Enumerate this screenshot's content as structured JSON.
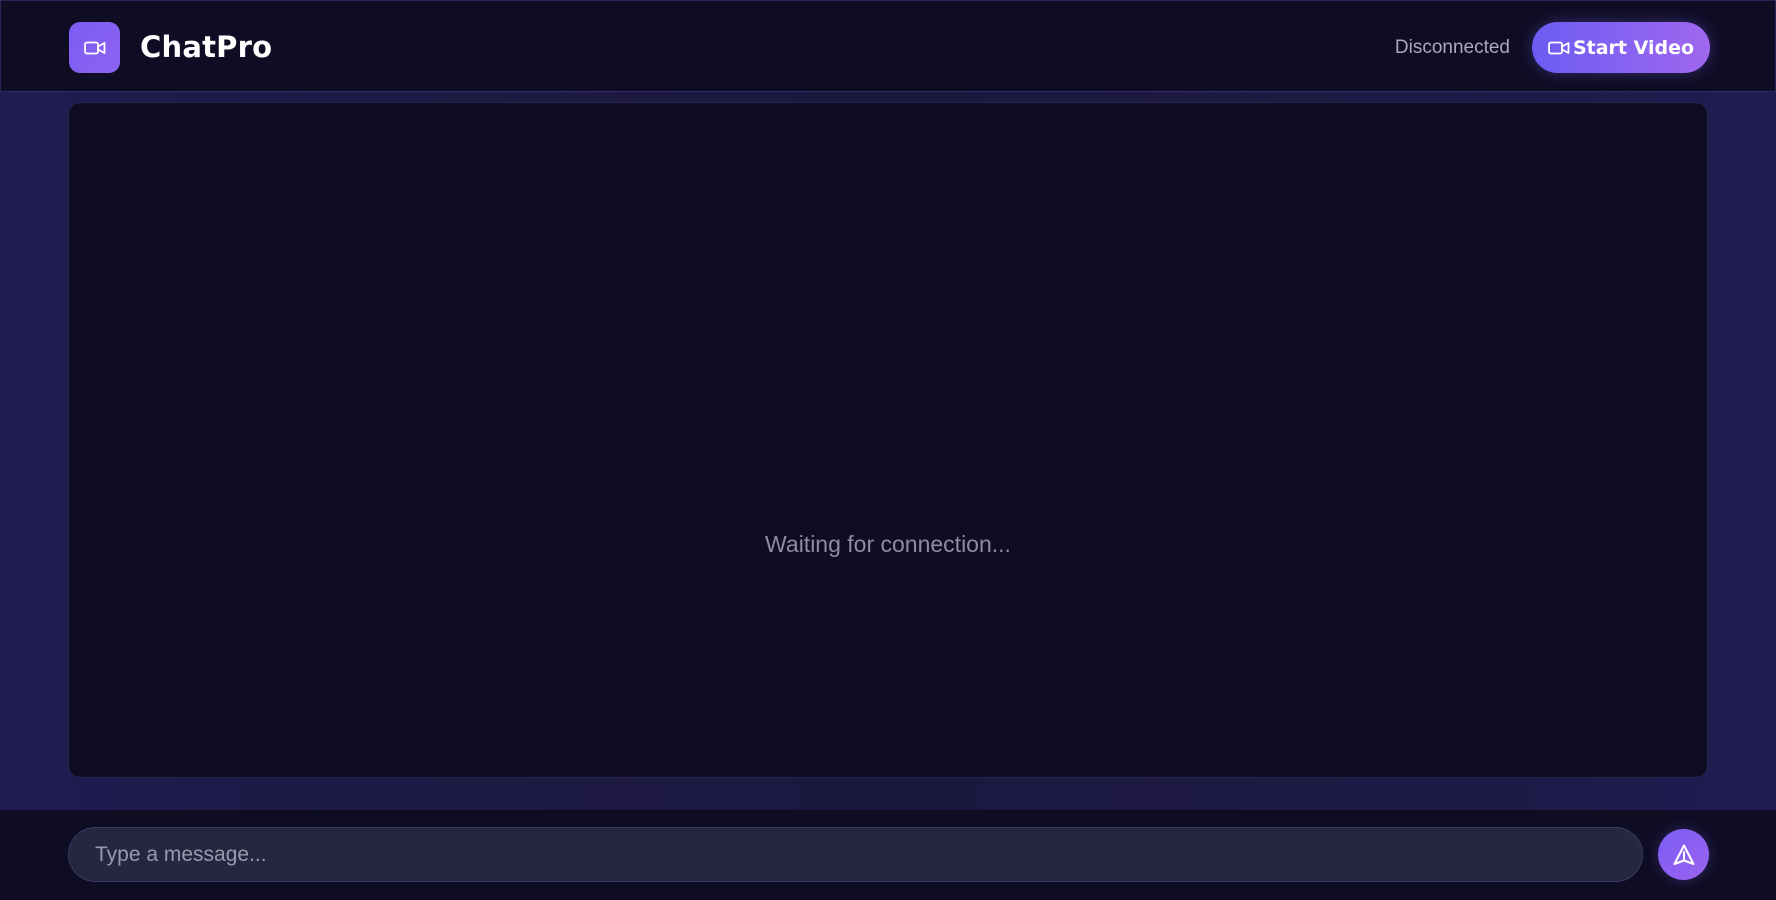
{
  "header": {
    "brand": "ChatPro",
    "logo_icon": "video-camera-icon",
    "status": "Disconnected",
    "start_button_label": "Start Video",
    "start_button_icon": "video-camera-icon"
  },
  "video": {
    "placeholder": "Waiting for connection..."
  },
  "composer": {
    "placeholder": "Type a message...",
    "value": "",
    "send_icon": "send-icon"
  },
  "colors": {
    "accent": "#7c5cf5",
    "accent_end": "#a066ee",
    "background": "#0e0d24",
    "surround": "#1c1944",
    "input_bg": "#272640"
  }
}
